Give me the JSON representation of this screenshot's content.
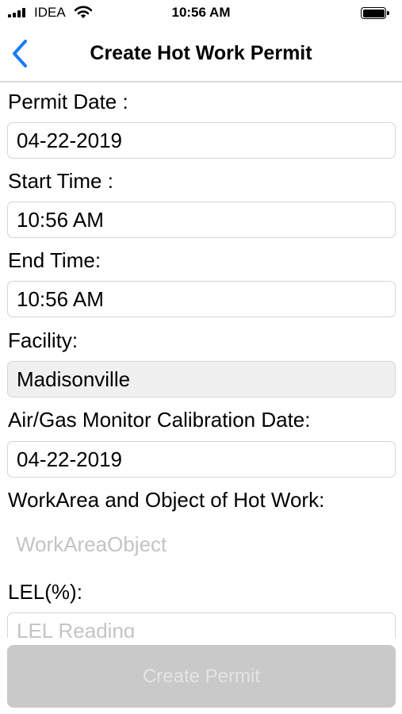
{
  "status_bar": {
    "carrier": "IDEA",
    "time": "10:56 AM",
    "signal_icon": "cellular-signal-icon",
    "wifi_icon": "wifi-icon",
    "battery_icon": "battery-icon",
    "battery_level": 1.0
  },
  "nav": {
    "title": "Create Hot Work Permit",
    "back_icon": "chevron-left-icon",
    "accent_color": "#1a7cf5"
  },
  "form": {
    "permit_date_label": "Permit Date :",
    "permit_date_value": "04-22-2019",
    "start_time_label": "Start Time :",
    "start_time_value": "10:56 AM",
    "end_time_label": "End Time:",
    "end_time_value": "10:56 AM",
    "facility_label": "Facility:",
    "facility_value": "Madisonville",
    "calibration_label": "Air/Gas Monitor Calibration Date:",
    "calibration_value": "04-22-2019",
    "work_area_label": "WorkArea and Object of Hot Work:",
    "work_area_placeholder": "WorkAreaObject",
    "lel_label": "LEL(%):",
    "lel_placeholder": "LEL Reading"
  },
  "actions": {
    "create_label": "Create Permit"
  }
}
